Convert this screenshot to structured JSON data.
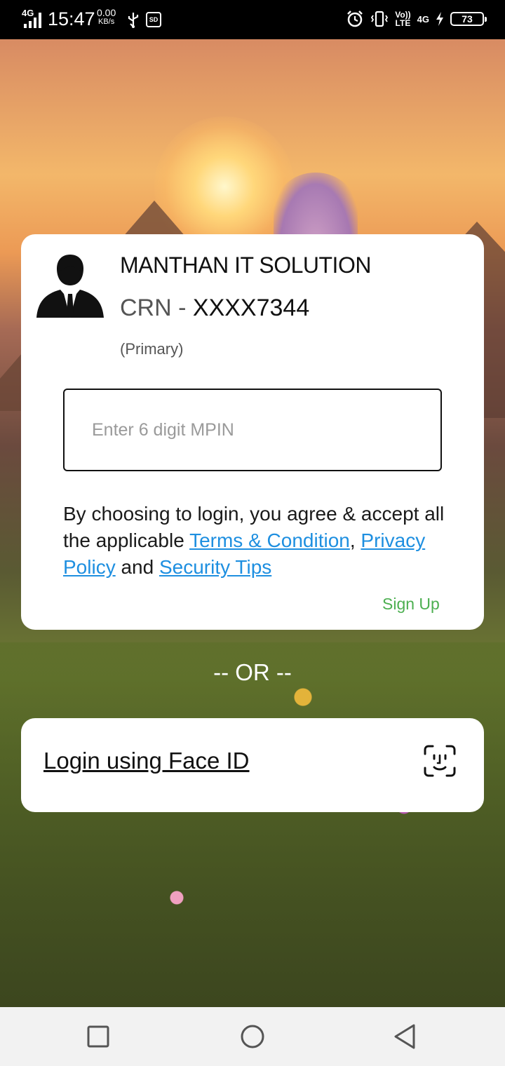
{
  "status_bar": {
    "network_type": "4G",
    "time": "15:47",
    "speed_value": "0.00",
    "speed_unit": "KB/s",
    "volte_top": "Vo))",
    "volte_bottom": "LTE",
    "net_right": "4G",
    "battery": "73"
  },
  "account": {
    "company": "MANTHAN IT SOLUTION",
    "crn_label": "CRN - ",
    "crn_value": "XXXX7344",
    "role": "(Primary)"
  },
  "mpin": {
    "placeholder": "Enter 6 digit MPIN",
    "value": ""
  },
  "consent": {
    "text_1": "By choosing to login, you agree & accept all the applicable ",
    "terms_link": "Terms & Condition",
    "text_2": ", ",
    "privacy_link": "Privacy Policy",
    "text_3": " and ",
    "security_link": "Security Tips"
  },
  "signup": {
    "label": "Sign Up"
  },
  "divider": {
    "label": "-- OR --"
  },
  "face_login": {
    "label": "Login using Face ID"
  },
  "colors": {
    "link": "#1e8fe0",
    "signup": "#4caf50",
    "card": "#ffffff"
  }
}
